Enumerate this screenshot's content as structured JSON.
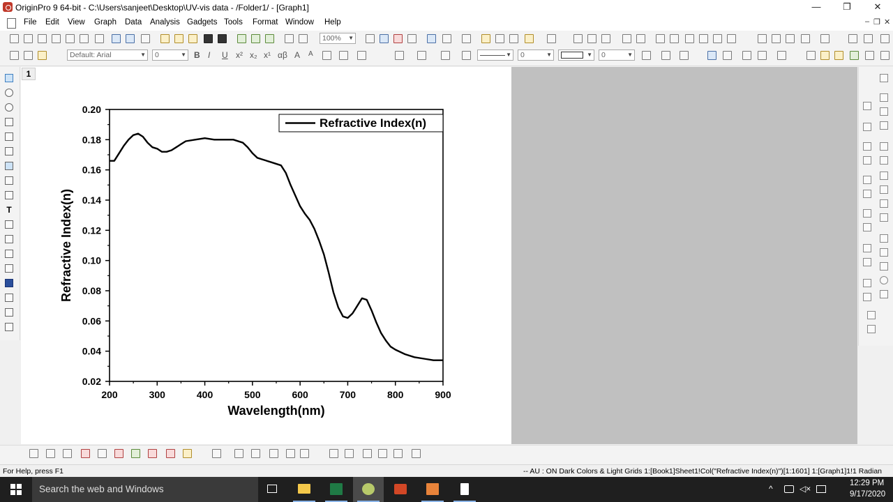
{
  "window": {
    "title": "OriginPro 9 64-bit - C:\\Users\\sanjeet\\Desktop\\UV-vis data - /Folder1/ - [Graph1]",
    "controls": [
      "—",
      "❐",
      "✕"
    ]
  },
  "menu": {
    "items": [
      "File",
      "Edit",
      "View",
      "Graph",
      "Data",
      "Analysis",
      "Gadgets",
      "Tools",
      "Format",
      "Window",
      "Help"
    ],
    "mdi_controls": [
      "–",
      "❐",
      "✕"
    ]
  },
  "toolbar": {
    "zoom": "100%",
    "font_name": "Default: Arial",
    "font_size": "0",
    "line_width": "0",
    "pattern_size": "0",
    "format_buttons": [
      "B",
      "I",
      "U",
      "x²",
      "x₂",
      "x¹",
      "αβ",
      "A",
      "A"
    ]
  },
  "graph": {
    "layer_label": "1"
  },
  "chart_data": {
    "type": "line",
    "title": "",
    "xlabel": "Wavelength(nm)",
    "ylabel": "Refractive Index(n)",
    "xlim": [
      200,
      900
    ],
    "ylim": [
      0.02,
      0.2
    ],
    "x_ticks": [
      "200",
      "300",
      "400",
      "500",
      "600",
      "700",
      "800",
      "900"
    ],
    "y_ticks": [
      "0.02",
      "0.04",
      "0.06",
      "0.08",
      "0.10",
      "0.12",
      "0.14",
      "0.16",
      "0.18",
      "0.20"
    ],
    "grid": false,
    "legend_position": "top-right",
    "series": [
      {
        "name": "Refractive Index(n)",
        "color": "#000000",
        "x": [
          200,
          210,
          220,
          230,
          240,
          250,
          260,
          270,
          280,
          290,
          300,
          310,
          320,
          330,
          340,
          350,
          360,
          380,
          400,
          420,
          440,
          460,
          480,
          490,
          500,
          510,
          520,
          540,
          560,
          570,
          580,
          590,
          600,
          610,
          620,
          630,
          640,
          650,
          660,
          670,
          680,
          690,
          700,
          710,
          720,
          730,
          740,
          750,
          760,
          770,
          780,
          790,
          800,
          820,
          840,
          860,
          880,
          900
        ],
        "y": [
          0.166,
          0.166,
          0.171,
          0.176,
          0.18,
          0.183,
          0.184,
          0.182,
          0.178,
          0.175,
          0.174,
          0.172,
          0.172,
          0.173,
          0.175,
          0.177,
          0.179,
          0.18,
          0.181,
          0.18,
          0.18,
          0.18,
          0.178,
          0.175,
          0.171,
          0.168,
          0.167,
          0.165,
          0.163,
          0.158,
          0.15,
          0.143,
          0.136,
          0.131,
          0.127,
          0.121,
          0.113,
          0.104,
          0.092,
          0.079,
          0.069,
          0.063,
          0.062,
          0.065,
          0.07,
          0.075,
          0.074,
          0.067,
          0.059,
          0.052,
          0.047,
          0.043,
          0.041,
          0.038,
          0.036,
          0.035,
          0.034,
          0.034
        ]
      }
    ]
  },
  "statusbar": {
    "help": "For Help, press F1",
    "info": "-- AU : ON  Dark Colors & Light Grids  1:[Book1]Sheet1!Col(\"Refractive Index(n)\")[1:1601]  1:[Graph1]1!1  Radian"
  },
  "taskbar": {
    "search_placeholder": "Search the web and Windows",
    "time": "12:29 PM",
    "date": "9/17/2020"
  }
}
